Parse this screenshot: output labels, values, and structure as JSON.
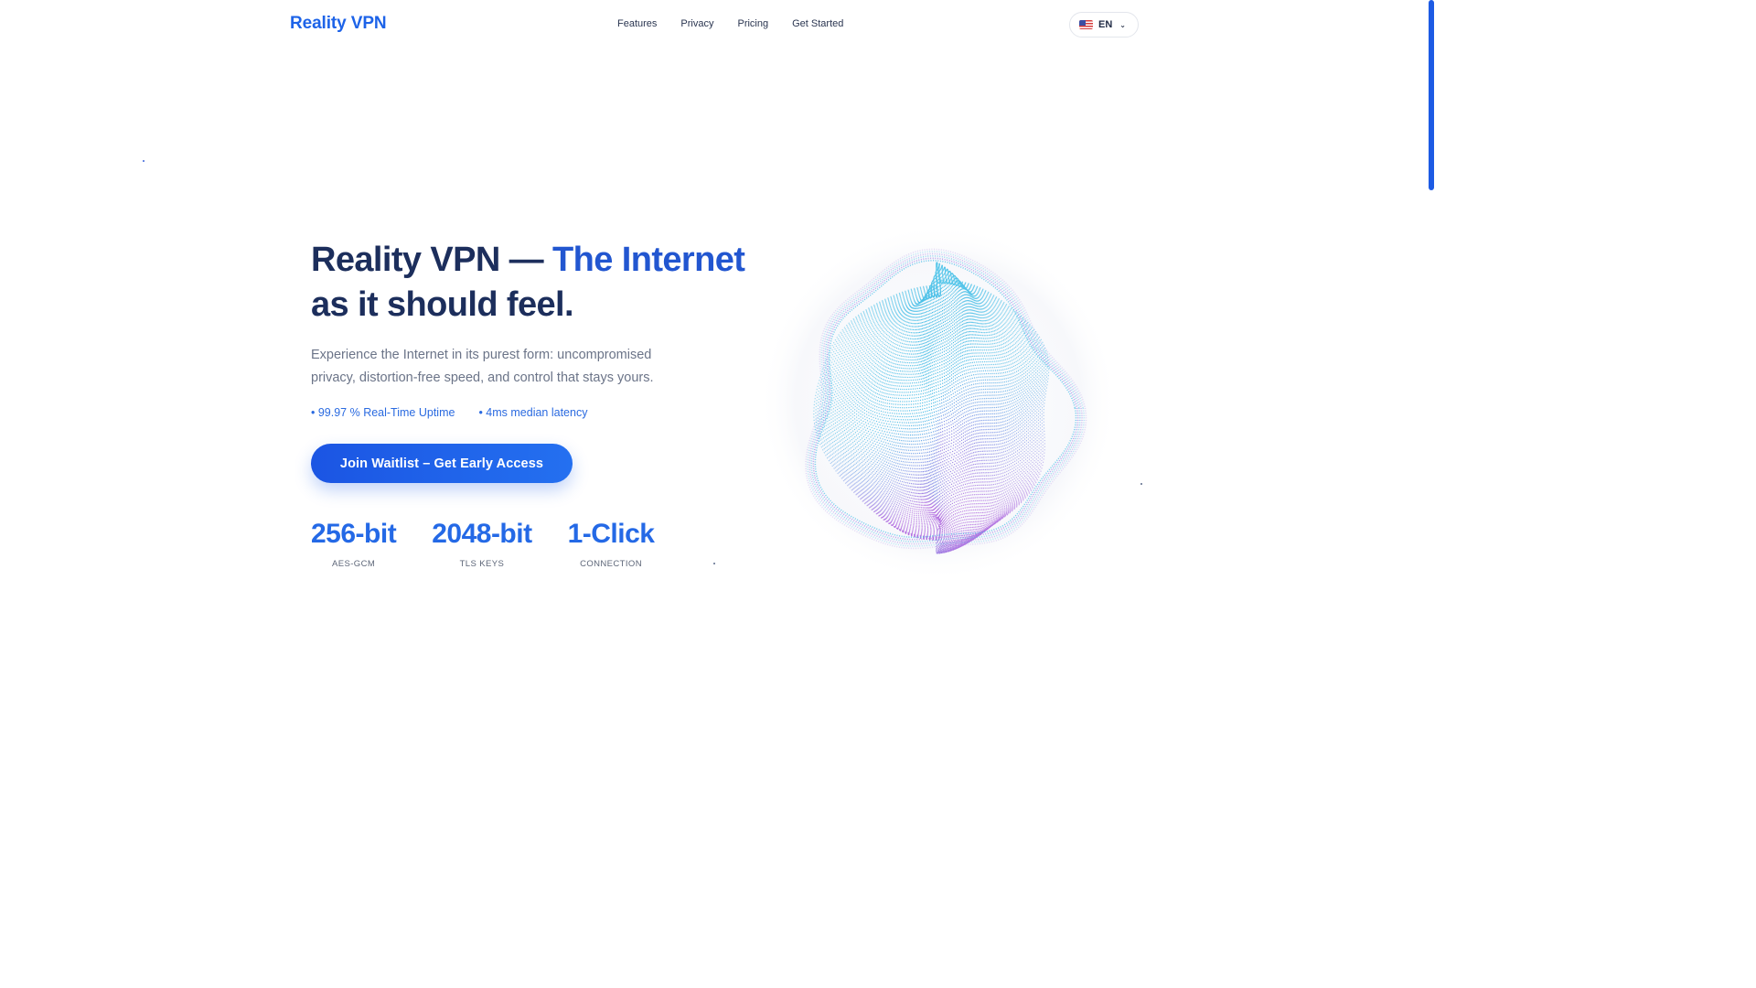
{
  "header": {
    "brand": "Reality VPN",
    "nav": [
      "Features",
      "Privacy",
      "Pricing",
      "Get Started"
    ],
    "language": {
      "code": "EN",
      "flag_icon": "us-flag-icon"
    }
  },
  "hero": {
    "title_part1": "Reality VPN — ",
    "title_accent": "The Internet",
    "title_part2": "as it should feel.",
    "subtitle": "Experience the Internet in its purest form: uncompromised privacy, distortion-free speed, and control that stays yours.",
    "bullets": [
      "• 99.97 % Real-Time Uptime",
      "• 4ms median latency"
    ],
    "cta_label": "Join Waitlist – Get Early Access"
  },
  "stats": [
    {
      "value": "256-bit",
      "label": "AES-GCM"
    },
    {
      "value": "2048-bit",
      "label": "TLS KEYS"
    },
    {
      "value": "1-Click",
      "label": "CONNECTION"
    }
  ],
  "colors": {
    "accent": "#1d63e8",
    "heading": "#1c2e5c",
    "globe_cyan": "#3bbfe6",
    "globe_violet": "#a66ee0"
  },
  "icons": {
    "chevron": "chevron-down-icon",
    "globe": "particle-globe-graphic"
  }
}
